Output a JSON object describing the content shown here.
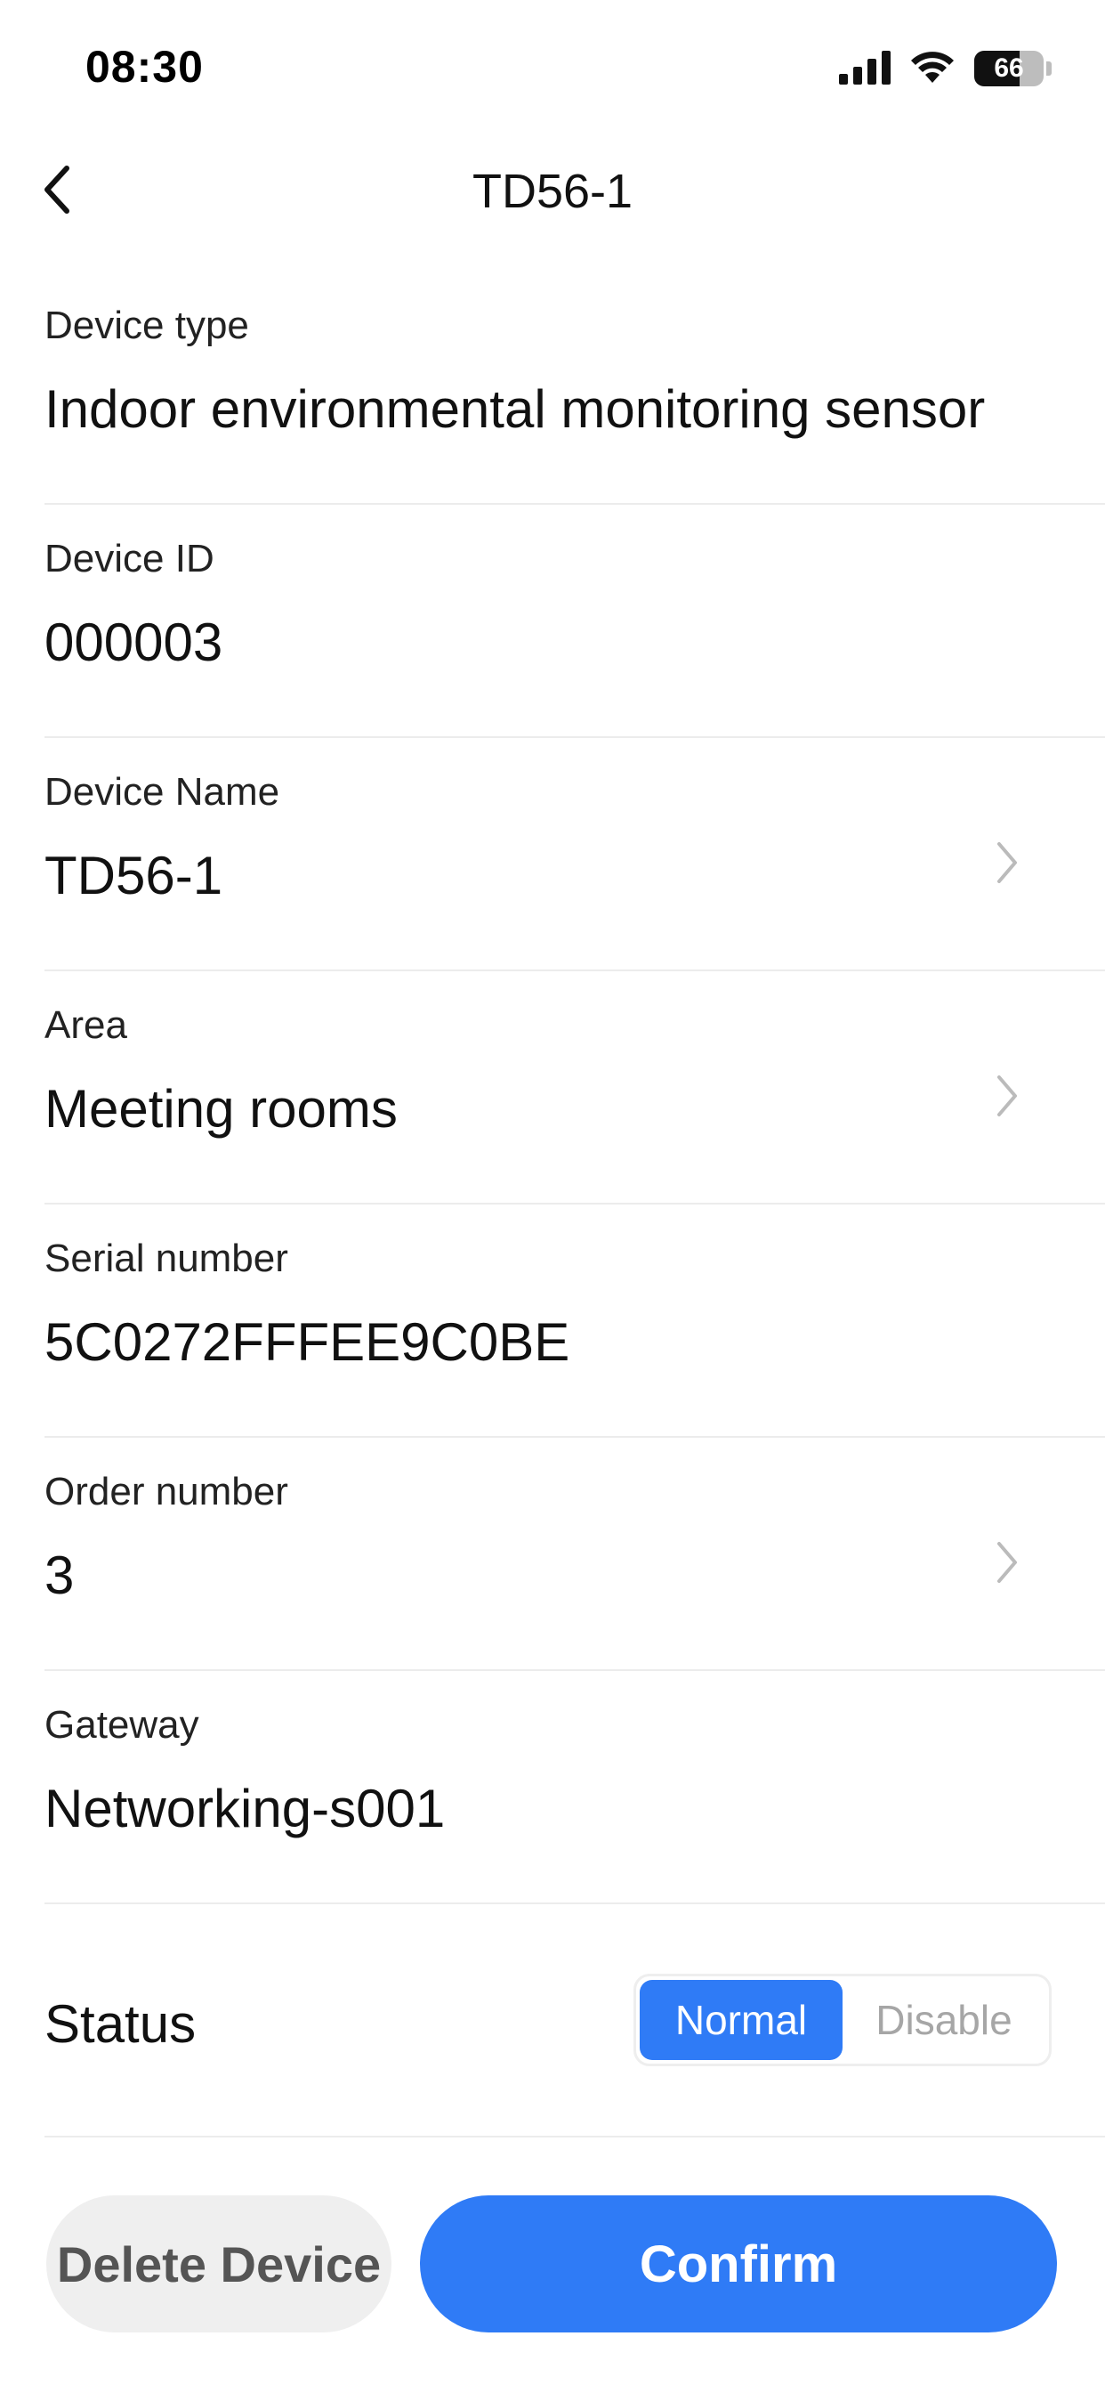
{
  "status_bar": {
    "time": "08:30",
    "battery_percent": "66",
    "battery_level": 0.66,
    "icons": [
      "cellular-signal-icon",
      "wifi-icon",
      "battery-icon"
    ]
  },
  "nav": {
    "title": "TD56-1",
    "back_icon": "chevron-left-icon"
  },
  "fields": [
    {
      "label": "Device type",
      "value": "Indoor environmental monitoring sensor",
      "editable": false
    },
    {
      "label": "Device ID",
      "value": "000003",
      "editable": false
    },
    {
      "label": "Device Name",
      "value": "TD56-1",
      "editable": true
    },
    {
      "label": "Area",
      "value": "Meeting rooms",
      "editable": true
    },
    {
      "label": "Serial number",
      "value": "5C0272FFFEE9C0BE",
      "editable": false
    },
    {
      "label": "Order number",
      "value": "3",
      "editable": true
    },
    {
      "label": "Gateway",
      "value": "Networking-s001",
      "editable": false
    }
  ],
  "status": {
    "label": "Status",
    "options": [
      "Normal",
      "Disable"
    ],
    "selected": "Normal"
  },
  "actions": {
    "delete_label": "Delete Device",
    "confirm_label": "Confirm"
  },
  "colors": {
    "accent": "#2f7bf6",
    "divider": "#ececec",
    "delete_bg": "#efefef",
    "delete_text": "#555555",
    "inactive_text": "#a6a6a6",
    "chevron": "#bbbbbb"
  }
}
